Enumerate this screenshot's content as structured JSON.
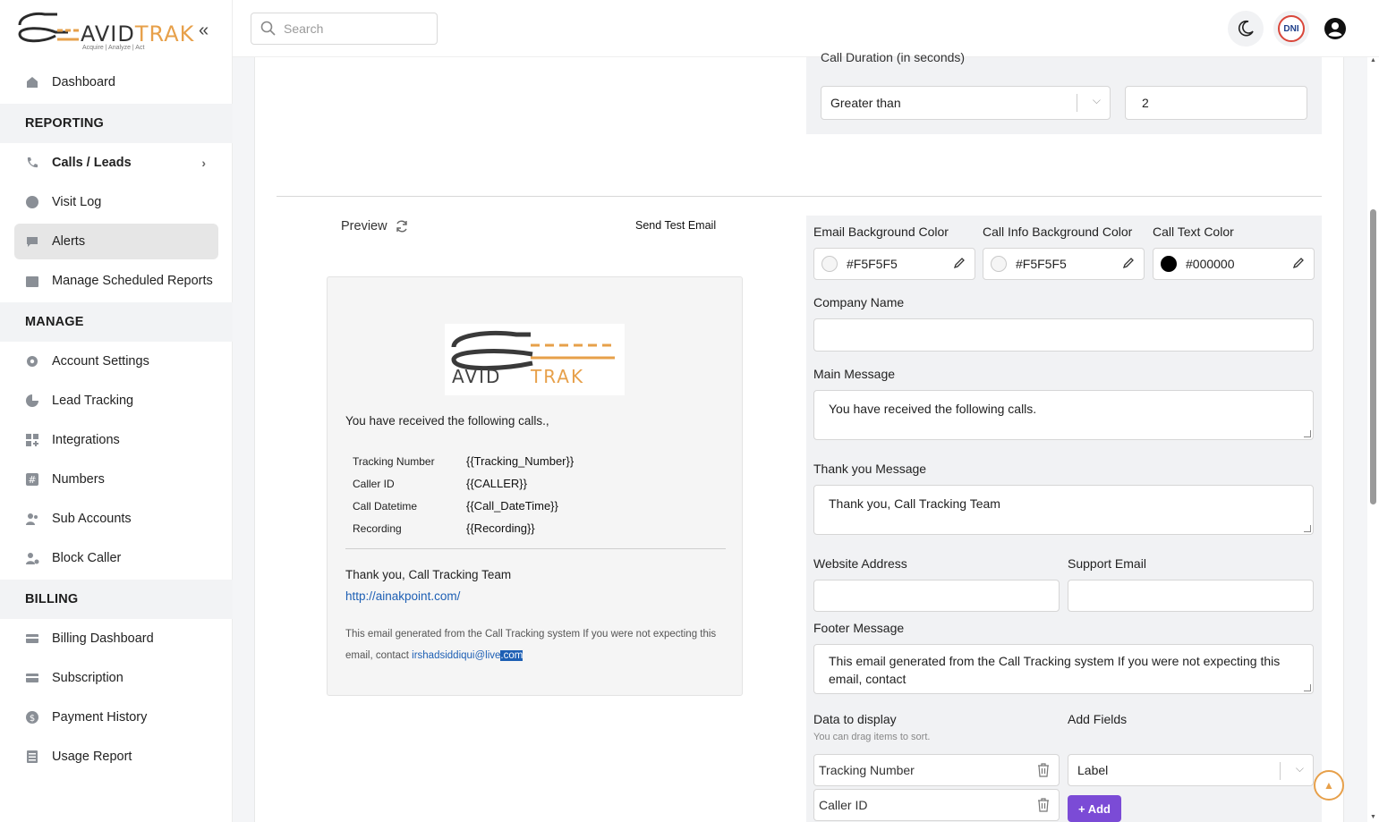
{
  "brand": {
    "name": "AVIDTRAK",
    "tagline": "Acquire  |  Analyze  |  Act"
  },
  "sidebar": {
    "dashboard": "Dashboard",
    "sections": {
      "reporting": "REPORTING",
      "manage": "MANAGE",
      "billing": "BILLING"
    },
    "reporting_items": [
      {
        "label": "Calls / Leads",
        "icon": "phone-icon"
      },
      {
        "label": "Visit Log",
        "icon": "globe-icon"
      },
      {
        "label": "Alerts",
        "icon": "chat-icon"
      },
      {
        "label": "Manage Scheduled Reports",
        "icon": "calendar-icon"
      }
    ],
    "manage_items": [
      {
        "label": "Account Settings",
        "icon": "gear-icon"
      },
      {
        "label": "Lead Tracking",
        "icon": "pie-icon"
      },
      {
        "label": "Integrations",
        "icon": "grid-plus-icon"
      },
      {
        "label": "Numbers",
        "icon": "hash-icon"
      },
      {
        "label": "Sub Accounts",
        "icon": "users-icon"
      },
      {
        "label": "Block Caller",
        "icon": "user-block-icon"
      }
    ],
    "billing_items": [
      {
        "label": "Billing Dashboard",
        "icon": "card-icon"
      },
      {
        "label": "Subscription",
        "icon": "card-clock-icon"
      },
      {
        "label": "Payment History",
        "icon": "dollar-icon"
      },
      {
        "label": "Usage Report",
        "icon": "report-icon"
      }
    ]
  },
  "topbar": {
    "search_placeholder": "Search",
    "dni_label": "DNI"
  },
  "filter": {
    "label": "Call Duration (in seconds)",
    "operator": "Greater than",
    "value": "2"
  },
  "preview": {
    "label": "Preview",
    "send_test": "Send Test Email",
    "main_message": "You have received the following calls.,",
    "rows": [
      {
        "key": "Tracking Number",
        "value": "{{Tracking_Number}}"
      },
      {
        "key": "Caller ID",
        "value": "{{CALLER}}"
      },
      {
        "key": "Call Datetime",
        "value": "{{Call_DateTime}}"
      },
      {
        "key": "Recording",
        "value": "{{Recording}}"
      }
    ],
    "thanks": "Thank you, Call Tracking Team",
    "link": "http://ainakpoint.com/",
    "footer_text": "This email generated from the Call Tracking system If you were not expecting this email, contact ",
    "footer_email_a": "irshadsiddiqui@live",
    "footer_email_b": ".com"
  },
  "settings": {
    "email_bg_label": "Email Background Color",
    "email_bg_value": "#F5F5F5",
    "call_info_bg_label": "Call Info Background Color",
    "call_info_bg_value": "#F5F5F5",
    "call_text_label": "Call Text Color",
    "call_text_value": "#000000",
    "company_label": "Company Name",
    "company_value": "",
    "main_message_label": "Main Message",
    "main_message_value": "You have received the following calls.",
    "thank_label": "Thank you Message",
    "thank_value": "Thank you, Call Tracking Team",
    "website_label": "Website Address",
    "support_label": "Support Email",
    "footer_label": "Footer Message",
    "footer_value": "This email generated from the Call Tracking system If you were not expecting this email, contact",
    "data_display_label": "Data to display",
    "data_display_hint": "You can drag items to sort.",
    "add_fields_label": "Add Fields",
    "display_items": [
      "Tracking Number",
      "Caller ID"
    ],
    "add_select": "Label",
    "add_button": "+ Add"
  },
  "colors": {
    "accent": "#7b4bd6",
    "brand_orange": "#e7a04a",
    "dni_ring": "#d9463a"
  }
}
